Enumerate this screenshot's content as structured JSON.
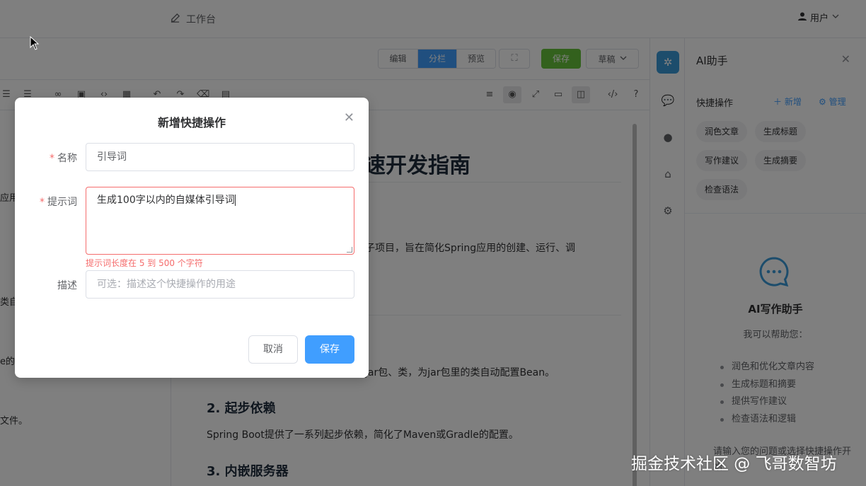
{
  "header": {
    "workspace_label": "工作台",
    "user_label": "用户"
  },
  "editor_toolbar": {
    "mode_tabs": [
      "编辑",
      "分栏",
      "预览"
    ],
    "active_mode": "分栏",
    "save_label": "保存",
    "draft_label": "草稿"
  },
  "left_pane": {
    "fragments": [
      "应用",
      "类自",
      "e的配",
      "文件。"
    ]
  },
  "preview": {
    "heading": "速开发指南",
    "para1": "子项目，旨在简化Spring应用的创建、运行、调",
    "para2": "jar包、类，为jar包里的类自动配置Bean。",
    "section2_title": "2. 起步依赖",
    "section2_text": "Spring Boot提供了一系列起步依赖，简化了Maven或Gradle的配置。",
    "section3_title": "3. 内嵌服务器"
  },
  "ai_panel": {
    "title": "AI助手",
    "quick_ops_label": "快捷操作",
    "add_label": "新增",
    "manage_label": "管理",
    "chips": [
      "润色文章",
      "生成标题",
      "写作建议",
      "生成摘要",
      "检查语法"
    ],
    "assistant_title": "AI写作助手",
    "assistant_subtitle": "我可以帮助您：",
    "capabilities": [
      "润色和优化文章内容",
      "生成标题和摘要",
      "提供写作建议",
      "检查语法和逻辑"
    ],
    "hint": "请输入您的问题或选择快捷操作开始"
  },
  "dialog": {
    "title": "新增快捷操作",
    "name_label": "名称",
    "name_value": "引导词",
    "prompt_label": "提示词",
    "prompt_value": "生成100字以内的自媒体引导词",
    "prompt_error": "提示词长度在 5 到 500 个字符",
    "desc_label": "描述",
    "desc_placeholder": "可选：描述这个快捷操作的用途",
    "cancel_label": "取消",
    "save_label": "保存"
  },
  "watermark": "掘金技术社区 @ 飞哥数智坊",
  "colors": {
    "primary": "#409eff",
    "success": "#67c23a",
    "danger": "#f56c6c",
    "ai_icon": "#3a9bd9"
  }
}
